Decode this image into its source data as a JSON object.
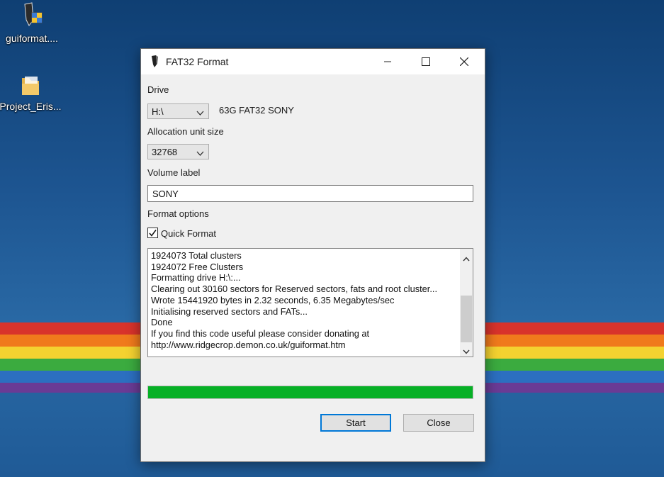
{
  "desktop": {
    "icons": [
      {
        "label": "guiformat....",
        "icon": "guiformat-app-icon"
      },
      {
        "label": "Project_Eris...",
        "icon": "folder-icon"
      }
    ]
  },
  "window": {
    "title": "FAT32 Format",
    "title_icon": "guiformat-app-icon",
    "controls": {
      "minimize": "minimize-icon",
      "maximize": "maximize-icon",
      "close": "close-icon"
    }
  },
  "form": {
    "drive_label": "Drive",
    "drive_value": "H:\\",
    "drive_info": "63G FAT32 SONY",
    "alloc_label": "Allocation unit size",
    "alloc_value": "32768",
    "volume_label": "Volume label",
    "volume_value": "SONY",
    "format_options_label": "Format options",
    "quick_format_label": "Quick Format",
    "quick_format_checked": true
  },
  "log": {
    "lines": [
      "1924073 Total clusters",
      "1924072 Free Clusters",
      "Formatting drive H:\\:...",
      "Clearing out 30160 sectors for Reserved sectors, fats and root cluster...",
      "Wrote 15441920 bytes in 2.32 seconds, 6.35 Megabytes/sec",
      "Initialising reserved sectors and FATs...",
      "Done",
      "If you find this code useful please consider donating at",
      "http://www.ridgecrop.demon.co.uk/guiformat.htm"
    ]
  },
  "progress": {
    "value": 1.0,
    "color": "#06b025"
  },
  "buttons": {
    "start": "Start",
    "close": "Close"
  },
  "colors": {
    "accent": "#0078d7",
    "progress": "#06b025"
  }
}
